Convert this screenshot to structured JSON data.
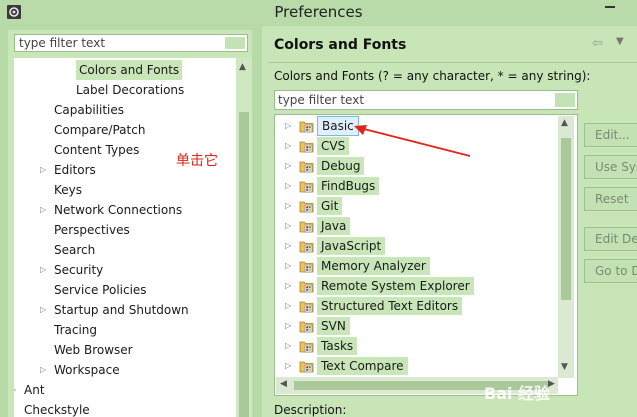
{
  "window": {
    "title": "Preferences"
  },
  "left": {
    "filter_placeholder": "type filter text",
    "items": [
      {
        "label": "Colors and Fonts",
        "indent": 2,
        "arrow": false,
        "selected": true
      },
      {
        "label": "Label Decorations",
        "indent": 2,
        "arrow": false
      },
      {
        "label": "Capabilities",
        "indent": 1,
        "arrow": false
      },
      {
        "label": "Compare/Patch",
        "indent": 1,
        "arrow": false
      },
      {
        "label": "Content Types",
        "indent": 1,
        "arrow": false
      },
      {
        "label": "Editors",
        "indent": 1,
        "arrow": true
      },
      {
        "label": "Keys",
        "indent": 1,
        "arrow": false
      },
      {
        "label": "Network Connections",
        "indent": 1,
        "arrow": true
      },
      {
        "label": "Perspectives",
        "indent": 1,
        "arrow": false
      },
      {
        "label": "Search",
        "indent": 1,
        "arrow": false
      },
      {
        "label": "Security",
        "indent": 1,
        "arrow": true
      },
      {
        "label": "Service Policies",
        "indent": 1,
        "arrow": false
      },
      {
        "label": "Startup and Shutdown",
        "indent": 1,
        "arrow": true
      },
      {
        "label": "Tracing",
        "indent": 1,
        "arrow": false
      },
      {
        "label": "Web Browser",
        "indent": 1,
        "arrow": false
      },
      {
        "label": "Workspace",
        "indent": 1,
        "arrow": true
      },
      {
        "label": "Ant",
        "indent": 0,
        "arrow": true
      },
      {
        "label": "Checkstyle",
        "indent": 0,
        "arrow": false
      }
    ]
  },
  "right": {
    "title": "Colors and Fonts",
    "description": "Colors and Fonts (? = any character, * = any string):",
    "filter_placeholder": "type filter text",
    "tree": [
      "Basic",
      "CVS",
      "Debug",
      "FindBugs",
      "Git",
      "Java",
      "JavaScript",
      "Memory Analyzer",
      "Remote System Explorer",
      "Structured Text Editors",
      "SVN",
      "Tasks",
      "Text Compare"
    ],
    "selected_index": 0,
    "buttons": {
      "edit": "Edit...",
      "use_system": "Use System Font",
      "reset": "Reset",
      "edit_default": "Edit Default...",
      "go_to": "Go to Default"
    },
    "footer_label": "Description:"
  },
  "annotation": {
    "text": "单击它",
    "color": "#e2231a"
  },
  "watermark": "Bai 经验"
}
